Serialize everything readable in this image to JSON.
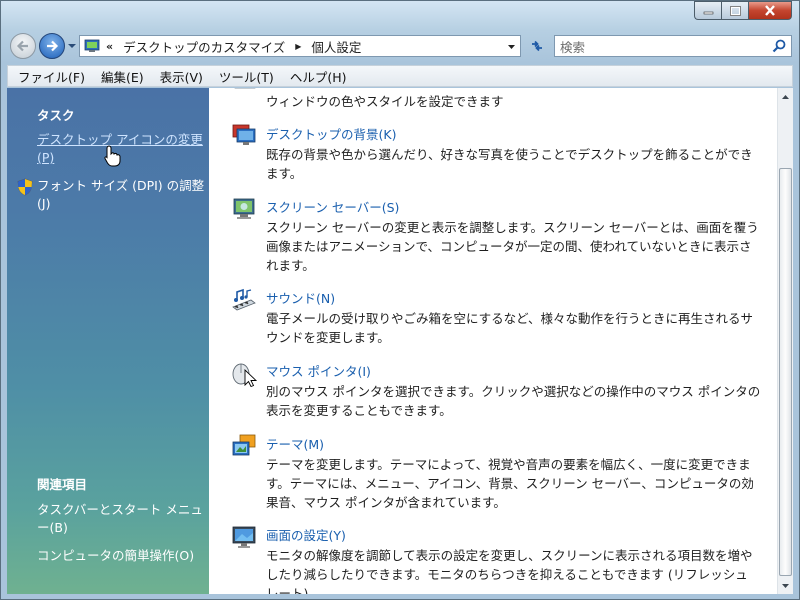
{
  "window": {
    "caption_buttons": [
      "minimize-icon",
      "maximize-icon",
      "close-icon"
    ]
  },
  "address": {
    "overflow_chevron": "«",
    "crumbs": [
      "デスクトップのカスタマイズ",
      "個人設定"
    ]
  },
  "search": {
    "placeholder": "検索"
  },
  "menu": [
    "ファイル(F)",
    "編集(E)",
    "表示(V)",
    "ツール(T)",
    "ヘルプ(H)"
  ],
  "sidebar": {
    "tasks_heading": "タスク",
    "tasks": [
      {
        "label": "デスクトップ アイコンの変更 (P)",
        "icon": ""
      },
      {
        "label": "フォント サイズ (DPI) の調整 (J)",
        "icon": "shield-icon"
      }
    ],
    "related_heading": "関連項目",
    "related": [
      "タスクバーとスタート メニュー(B)",
      "コンピュータの簡単操作(O)"
    ]
  },
  "content": {
    "partial_desc": "ウィンドウの色やスタイルを設定できます",
    "items": [
      {
        "title": "デスクトップの背景(K)",
        "desc": "既存の背景や色から選んだり、好きな写真を使うことでデスクトップを飾ることができます。",
        "icon": "desktop-background-icon"
      },
      {
        "title": "スクリーン セーバー(S)",
        "desc": "スクリーン セーバーの変更と表示を調整します。スクリーン セーバーとは、画面を覆う画像またはアニメーションで、コンピュータが一定の間、使われていないときに表示されます。",
        "icon": "screensaver-icon"
      },
      {
        "title": "サウンド(N)",
        "desc": "電子メールの受け取りやごみ箱を空にするなど、様々な動作を行うときに再生されるサウンドを変更します。",
        "icon": "sound-icon"
      },
      {
        "title": "マウス ポインタ(I)",
        "desc": "別のマウス ポインタを選択できます。クリックや選択などの操作中のマウス ポインタの表示を変更することもできます。",
        "icon": "mouse-pointer-icon"
      },
      {
        "title": "テーマ(M)",
        "desc": "テーマを変更します。テーマによって、視覚や音声の要素を幅広く、一度に変更できます。テーマには、メニュー、アイコン、背景、スクリーン セーバー、コンピュータの効果音、マウス ポインタが含まれています。",
        "icon": "theme-icon"
      },
      {
        "title": "画面の設定(Y)",
        "desc": "モニタの解像度を調節して表示の設定を変更し、スクリーンに表示される項目数を増やしたり減らしたりできます。モニタのちらつきを抑えることもできます (リフレッシュ レート)。",
        "icon": "display-settings-icon"
      }
    ]
  },
  "colors": {
    "link": "#1a5fae",
    "sidebar_top": "#4a72a6",
    "sidebar_bottom": "#6fb190"
  }
}
